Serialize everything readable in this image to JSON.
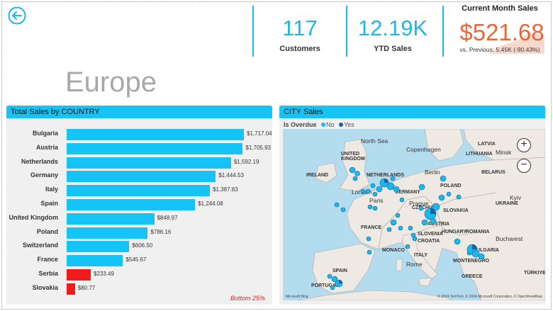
{
  "header": {
    "back_icon": "arrow-left-circle-icon",
    "kpis": [
      {
        "value": "117",
        "label": "Customers"
      },
      {
        "value": "12.19K",
        "label": "YTD Sales"
      }
    ],
    "current_month": {
      "title": "Current Month Sales",
      "value": "$521.68",
      "comparison": "vs. Previous: 5.45K (-90.43%)",
      "accent": "#e5683b"
    }
  },
  "region_title": "Europe",
  "sales_panel": {
    "title": "Total Sales by COUNTRY",
    "bottom_note": "Bottom 25%",
    "colors": {
      "normal": "#15c4f4",
      "bottom": "#f21a1a"
    }
  },
  "chart_data": {
    "type": "bar",
    "orientation": "horizontal",
    "title": "Total Sales by COUNTRY",
    "categories": [
      "Bulgaria",
      "Austria",
      "Netherlands",
      "Germany",
      "Italy",
      "Spain",
      "United Kingdom",
      "Poland",
      "Switzerland",
      "France",
      "Serbia",
      "Slovakia"
    ],
    "values": [
      1717.04,
      1705.93,
      1592.19,
      1444.53,
      1387.83,
      1244.08,
      848.97,
      786.16,
      606.5,
      545.67,
      233.49,
      80.77
    ],
    "value_labels": [
      "$1,717.04",
      "$1,705.93",
      "$1,592.19",
      "$1,444.53",
      "$1,387.83",
      "$1,244.08",
      "$848.97",
      "$786.16",
      "$606.50",
      "$545.67",
      "$233.49",
      "$80.77"
    ],
    "highlight": [
      "normal",
      "normal",
      "normal",
      "normal",
      "normal",
      "normal",
      "normal",
      "normal",
      "normal",
      "normal",
      "bottom",
      "bottom"
    ],
    "xlim": [
      0,
      1717.04
    ]
  },
  "map_panel": {
    "title": "CITY Sales",
    "legend_title": "Is Overdue",
    "legend": [
      {
        "label": "No",
        "color": "#1bb8e8"
      },
      {
        "label": "Yes",
        "color": "#1a5fa8"
      }
    ],
    "zoom_in": "+",
    "zoom_out": "−",
    "footer_brand": "Microsoft Bing",
    "credit": "© 2024 TomTom, © 2024 Microsoft Corporation, © OpenStreetMap"
  }
}
